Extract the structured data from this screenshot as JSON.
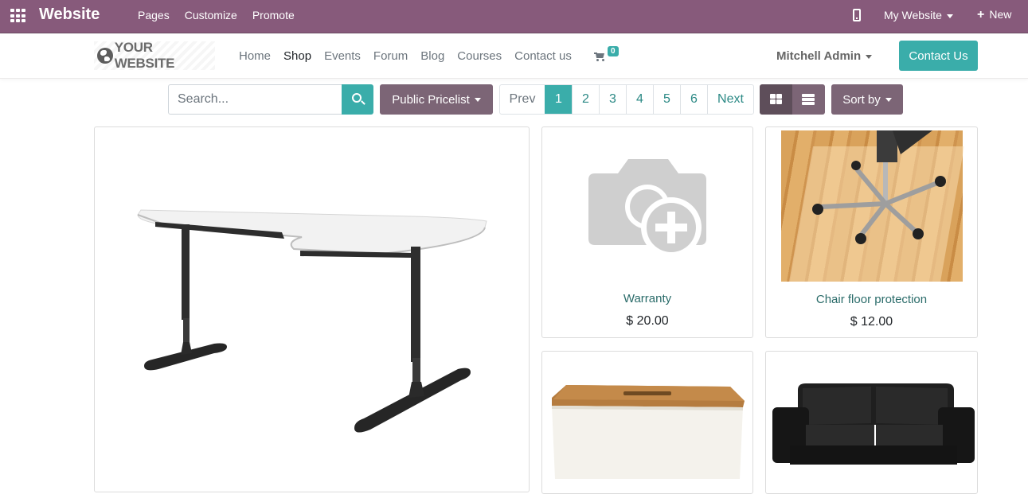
{
  "adminbar": {
    "brand": "Website",
    "menu": [
      "Pages",
      "Customize",
      "Promote"
    ],
    "website_selector": "My Website",
    "new_label": "New"
  },
  "header": {
    "logo_text": "YOUR WEBSITE",
    "nav": [
      "Home",
      "Shop",
      "Events",
      "Forum",
      "Blog",
      "Courses",
      "Contact us"
    ],
    "active_nav": "Shop",
    "cart_count": "0",
    "user": "Mitchell Admin",
    "contact_button": "Contact Us"
  },
  "toolbar": {
    "search_placeholder": "Search...",
    "pricelist": "Public Pricelist",
    "pager": [
      "Prev",
      "1",
      "2",
      "3",
      "4",
      "5",
      "6",
      "Next"
    ],
    "active_page": "1",
    "sort_label": "Sort by"
  },
  "products": [
    {
      "name": "Warranty",
      "price": "$ 20.00"
    },
    {
      "name": "Chair floor protection",
      "price": "$ 12.00"
    }
  ],
  "colors": {
    "admin_bar": "#875a7b",
    "primary_teal": "#3aadaa",
    "secondary_mauve": "#7c6576"
  }
}
